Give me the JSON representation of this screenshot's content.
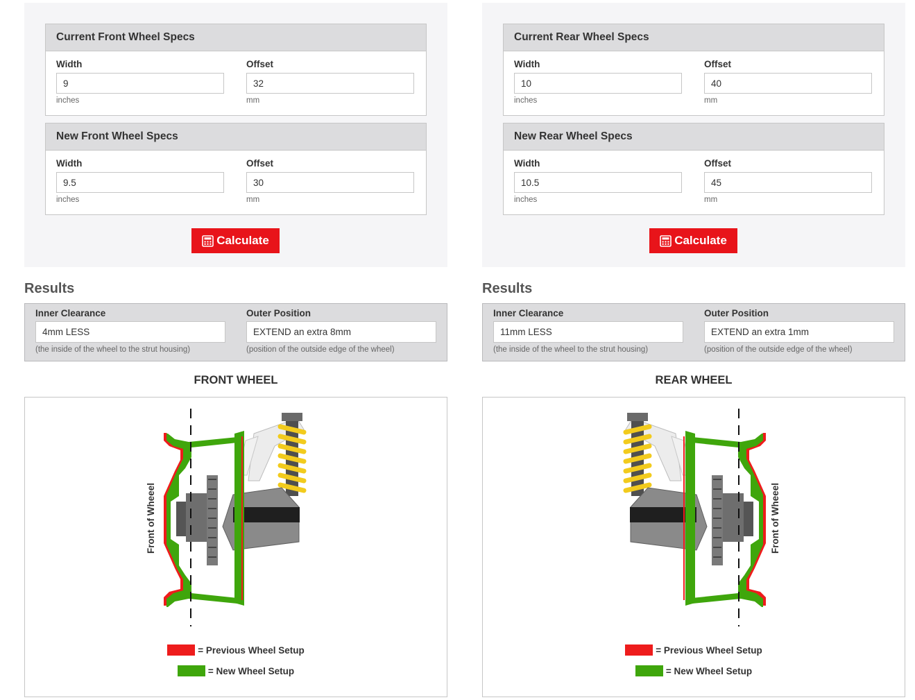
{
  "front": {
    "current": {
      "title": "Current Front Wheel Specs",
      "width_label": "Width",
      "width_value": "9",
      "width_unit": "inches",
      "offset_label": "Offset",
      "offset_value": "32",
      "offset_unit": "mm"
    },
    "new": {
      "title": "New Front Wheel Specs",
      "width_label": "Width",
      "width_value": "9.5",
      "width_unit": "inches",
      "offset_label": "Offset",
      "offset_value": "30",
      "offset_unit": "mm"
    },
    "calculate_label": "Calculate",
    "results_title": "Results",
    "inner_label": "Inner Clearance",
    "inner_value": "4mm LESS",
    "inner_note": "(the inside of the wheel to the strut housing)",
    "outer_label": "Outer Position",
    "outer_value": "EXTEND an extra 8mm",
    "outer_note": "(position of the outside edge of the wheel)",
    "wheel_title": "FRONT WHEEL",
    "diagram_label": "Front of Wheeel",
    "legend_prev": "= Previous Wheel Setup",
    "legend_new": "= New Wheel Setup"
  },
  "rear": {
    "current": {
      "title": "Current Rear Wheel Specs",
      "width_label": "Width",
      "width_value": "10",
      "width_unit": "inches",
      "offset_label": "Offset",
      "offset_value": "40",
      "offset_unit": "mm"
    },
    "new": {
      "title": "New Rear Wheel Specs",
      "width_label": "Width",
      "width_value": "10.5",
      "width_unit": "inches",
      "offset_label": "Offset",
      "offset_value": "45",
      "offset_unit": "mm"
    },
    "calculate_label": "Calculate",
    "results_title": "Results",
    "inner_label": "Inner Clearance",
    "inner_value": "11mm LESS",
    "inner_note": "(the inside of the wheel to the strut housing)",
    "outer_label": "Outer Position",
    "outer_value": "EXTEND an extra 1mm",
    "outer_note": "(position of the outside edge of the wheel)",
    "wheel_title": "REAR WHEEL",
    "diagram_label": "Front of Wheeel",
    "legend_prev": "= Previous Wheel Setup",
    "legend_new": "= New Wheel Setup"
  },
  "colors": {
    "accent": "#e8141a",
    "previous": "#ee1c1c",
    "new": "#3fa60c",
    "panel_bg": "#f5f5f7",
    "header_bg": "#dcdcde"
  },
  "icons": {
    "calculate": "calculator-icon"
  }
}
